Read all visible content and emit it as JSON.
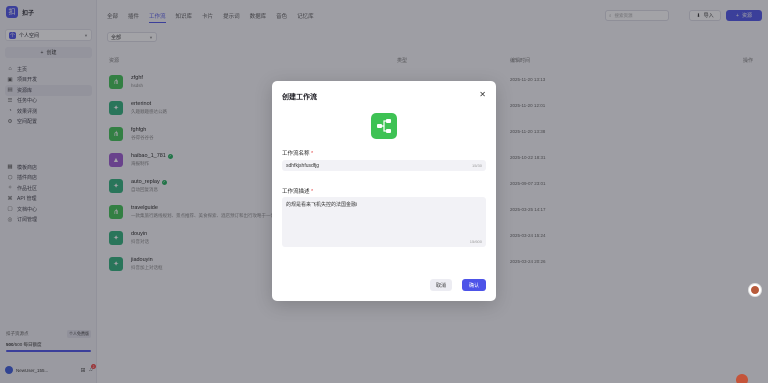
{
  "brand": {
    "logo_char": "扣",
    "name": "扣子"
  },
  "space": {
    "icon_char": "个",
    "label": "个人空间"
  },
  "create": {
    "label": "创建"
  },
  "nav_top": [
    {
      "icon": "home-icon",
      "glyph": "⌂",
      "label": "主页",
      "active": false
    },
    {
      "icon": "project-icon",
      "glyph": "▣",
      "label": "项目开发",
      "active": false
    },
    {
      "icon": "library-icon",
      "glyph": "▤",
      "label": "资源库",
      "active": true
    },
    {
      "icon": "task-icon",
      "glyph": "☰",
      "label": "任务中心",
      "active": false
    },
    {
      "icon": "eval-icon",
      "glyph": "◔",
      "label": "效果评测",
      "active": false
    },
    {
      "icon": "settings-icon",
      "glyph": "⚙",
      "label": "空间配置",
      "active": false
    }
  ],
  "nav_bottom": [
    {
      "icon": "template-icon",
      "glyph": "▦",
      "label": "模板商店"
    },
    {
      "icon": "plugin-store-icon",
      "glyph": "⬡",
      "label": "插件商店"
    },
    {
      "icon": "community-icon",
      "glyph": "✧",
      "label": "作品社区"
    },
    {
      "icon": "api-icon",
      "glyph": "⌘",
      "label": "API 管理"
    },
    {
      "icon": "docs-icon",
      "glyph": "▢",
      "label": "文档中心"
    },
    {
      "icon": "subscription-icon",
      "glyph": "◎",
      "label": "订阅管理"
    }
  ],
  "quota": {
    "title": "扣子资源点",
    "badge": "个人免费版",
    "value": "500",
    "suffix": "/500 每日额度",
    "fraction": 1.0
  },
  "user": {
    "name": "NewUser_155..."
  },
  "tabs": [
    "全部",
    "插件",
    "工作流",
    "知识库",
    "卡片",
    "提示词",
    "数据库",
    "音色",
    "记忆库"
  ],
  "active_tab": 2,
  "search": {
    "placeholder": "搜索资源"
  },
  "import": {
    "label": "导入"
  },
  "resource": {
    "label": "资源"
  },
  "filter": {
    "label": "全部"
  },
  "table": {
    "headers": {
      "resource": "资源",
      "type": "类型",
      "edited": "编辑时间",
      "actions": "操作"
    },
    "rows": [
      {
        "name": "zfghf",
        "desc": "hsdsh",
        "date": "2025-11-20 13:13",
        "color": "#3ec254",
        "glyph": "⋔",
        "published": false
      },
      {
        "name": "erterinot",
        "desc": "久趣顺趣感达公路",
        "date": "2025-11-20 12:01",
        "color": "#2db07a",
        "glyph": "✦",
        "published": false
      },
      {
        "name": "fghfgh",
        "desc": "谷得谷谷谷",
        "date": "2025-11-20 13:38",
        "color": "#3ec254",
        "glyph": "⋔",
        "published": false
      },
      {
        "name": "haibao_1_781",
        "desc": "海报制作",
        "date": "2025-10-22 18:31",
        "color": "#9b59d0",
        "glyph": "▲",
        "published": true
      },
      {
        "name": "auto_replay",
        "desc": "自动回复消息",
        "date": "2025-09-07 23:01",
        "color": "#2db07a",
        "glyph": "✦",
        "published": true
      },
      {
        "name": "travelguide",
        "desc": "一款集旅行路线规划、景点推荐、美食探索、酒店预订和出行攻略于一体的智能旅行助手",
        "date": "2025-03-25 14:17",
        "color": "#3ec254",
        "glyph": "⋔",
        "published": false
      },
      {
        "name": "douyin",
        "desc": "抖音对话",
        "date": "2025-03-24 15:24",
        "color": "#2db07a",
        "glyph": "✦",
        "published": false
      },
      {
        "name": "jiadouyin",
        "desc": "抖音加上对话框",
        "date": "2025-03-24 20:26",
        "color": "#2db07a",
        "glyph": "✦",
        "published": false
      }
    ]
  },
  "dialog": {
    "title": "创建工作流",
    "close": "✕",
    "name_label": "工作流名称",
    "name_value": "sdhfkjshfusdfjg",
    "name_counter": "15/30",
    "desc_label": "工作流描述",
    "desc_value": "的规是看来飞机失控的法国金融i",
    "desc_counter": "15/600",
    "cancel": "取消",
    "confirm": "确认",
    "required_mark": "*"
  },
  "colors": {
    "accent": "#4d53e8",
    "workflow_green": "#3ec254"
  }
}
